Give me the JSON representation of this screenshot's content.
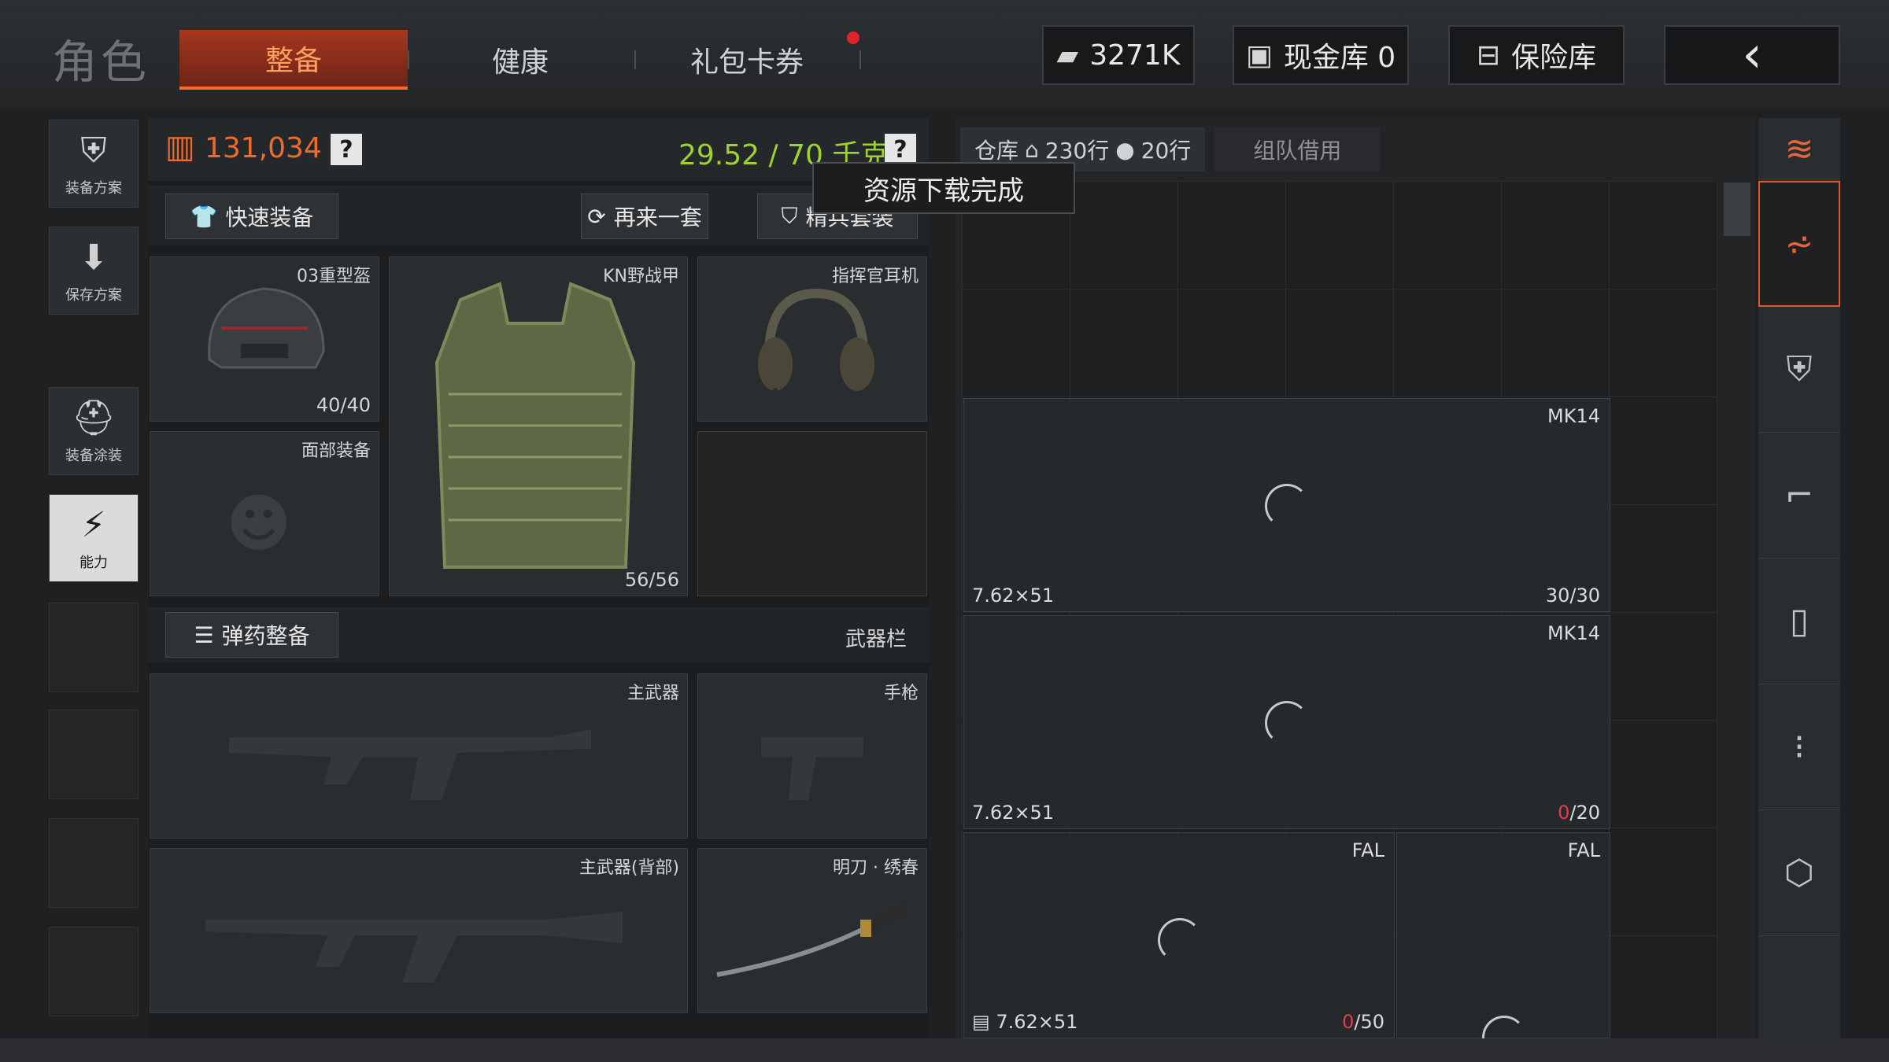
{
  "header": {
    "brand": "角色",
    "tabs": [
      {
        "label": "整备",
        "active": true
      },
      {
        "label": "健康",
        "active": false
      },
      {
        "label": "礼包卡券",
        "active": false
      }
    ],
    "money": "3271K",
    "cash_vault": "现金库 0",
    "safe": "保险库",
    "accent_color": "#ff6a2a",
    "notice_color": "#e0242b"
  },
  "left_rail": [
    {
      "label": "装备方案",
      "icon": "armor-plan-icon"
    },
    {
      "label": "保存方案",
      "icon": "download-icon"
    },
    {
      "label": "装备涂装",
      "icon": "paint-helmet-icon"
    },
    {
      "label": "能力",
      "icon": "ability-icon",
      "active": true
    }
  ],
  "loadout": {
    "capacity_value": "131,034",
    "help": "?",
    "weight": "29.52 / 70 千克",
    "weight_color": "#9ed22c",
    "quick_equip": "快速装备",
    "again": "再来一套",
    "elite_kit": "精兵套装",
    "slots": {
      "helmet": {
        "label": "03重型盔",
        "count": "40/40"
      },
      "armor": {
        "label": "KN野战甲",
        "count": "56/56"
      },
      "headset": {
        "label": "指挥官耳机"
      },
      "face": {
        "label": "面部装备"
      }
    },
    "ammo_button": "弹药整备",
    "weapon_bar": "武器栏",
    "weapons": {
      "primary": "主武器",
      "pistol": "手枪",
      "primary_back": "主武器(背部)",
      "melee": "明刀 · 绣春"
    }
  },
  "warehouse": {
    "tab": "仓库",
    "home_rows": "230行",
    "bag_rows": "20行",
    "team_borrow": "组队借用",
    "toast": "资源下载完成",
    "items": [
      {
        "name": "MK14",
        "caliber": "7.62×51",
        "count_cur": "30",
        "count_max": "30",
        "empty": false
      },
      {
        "name": "MK14",
        "caliber": "7.62×51",
        "count_cur": "0",
        "count_max": "20",
        "empty": true
      },
      {
        "name": "FAL",
        "caliber": "7.62×51",
        "count_cur": "0",
        "count_max": "50",
        "empty": true
      },
      {
        "name": "FAL"
      }
    ]
  }
}
